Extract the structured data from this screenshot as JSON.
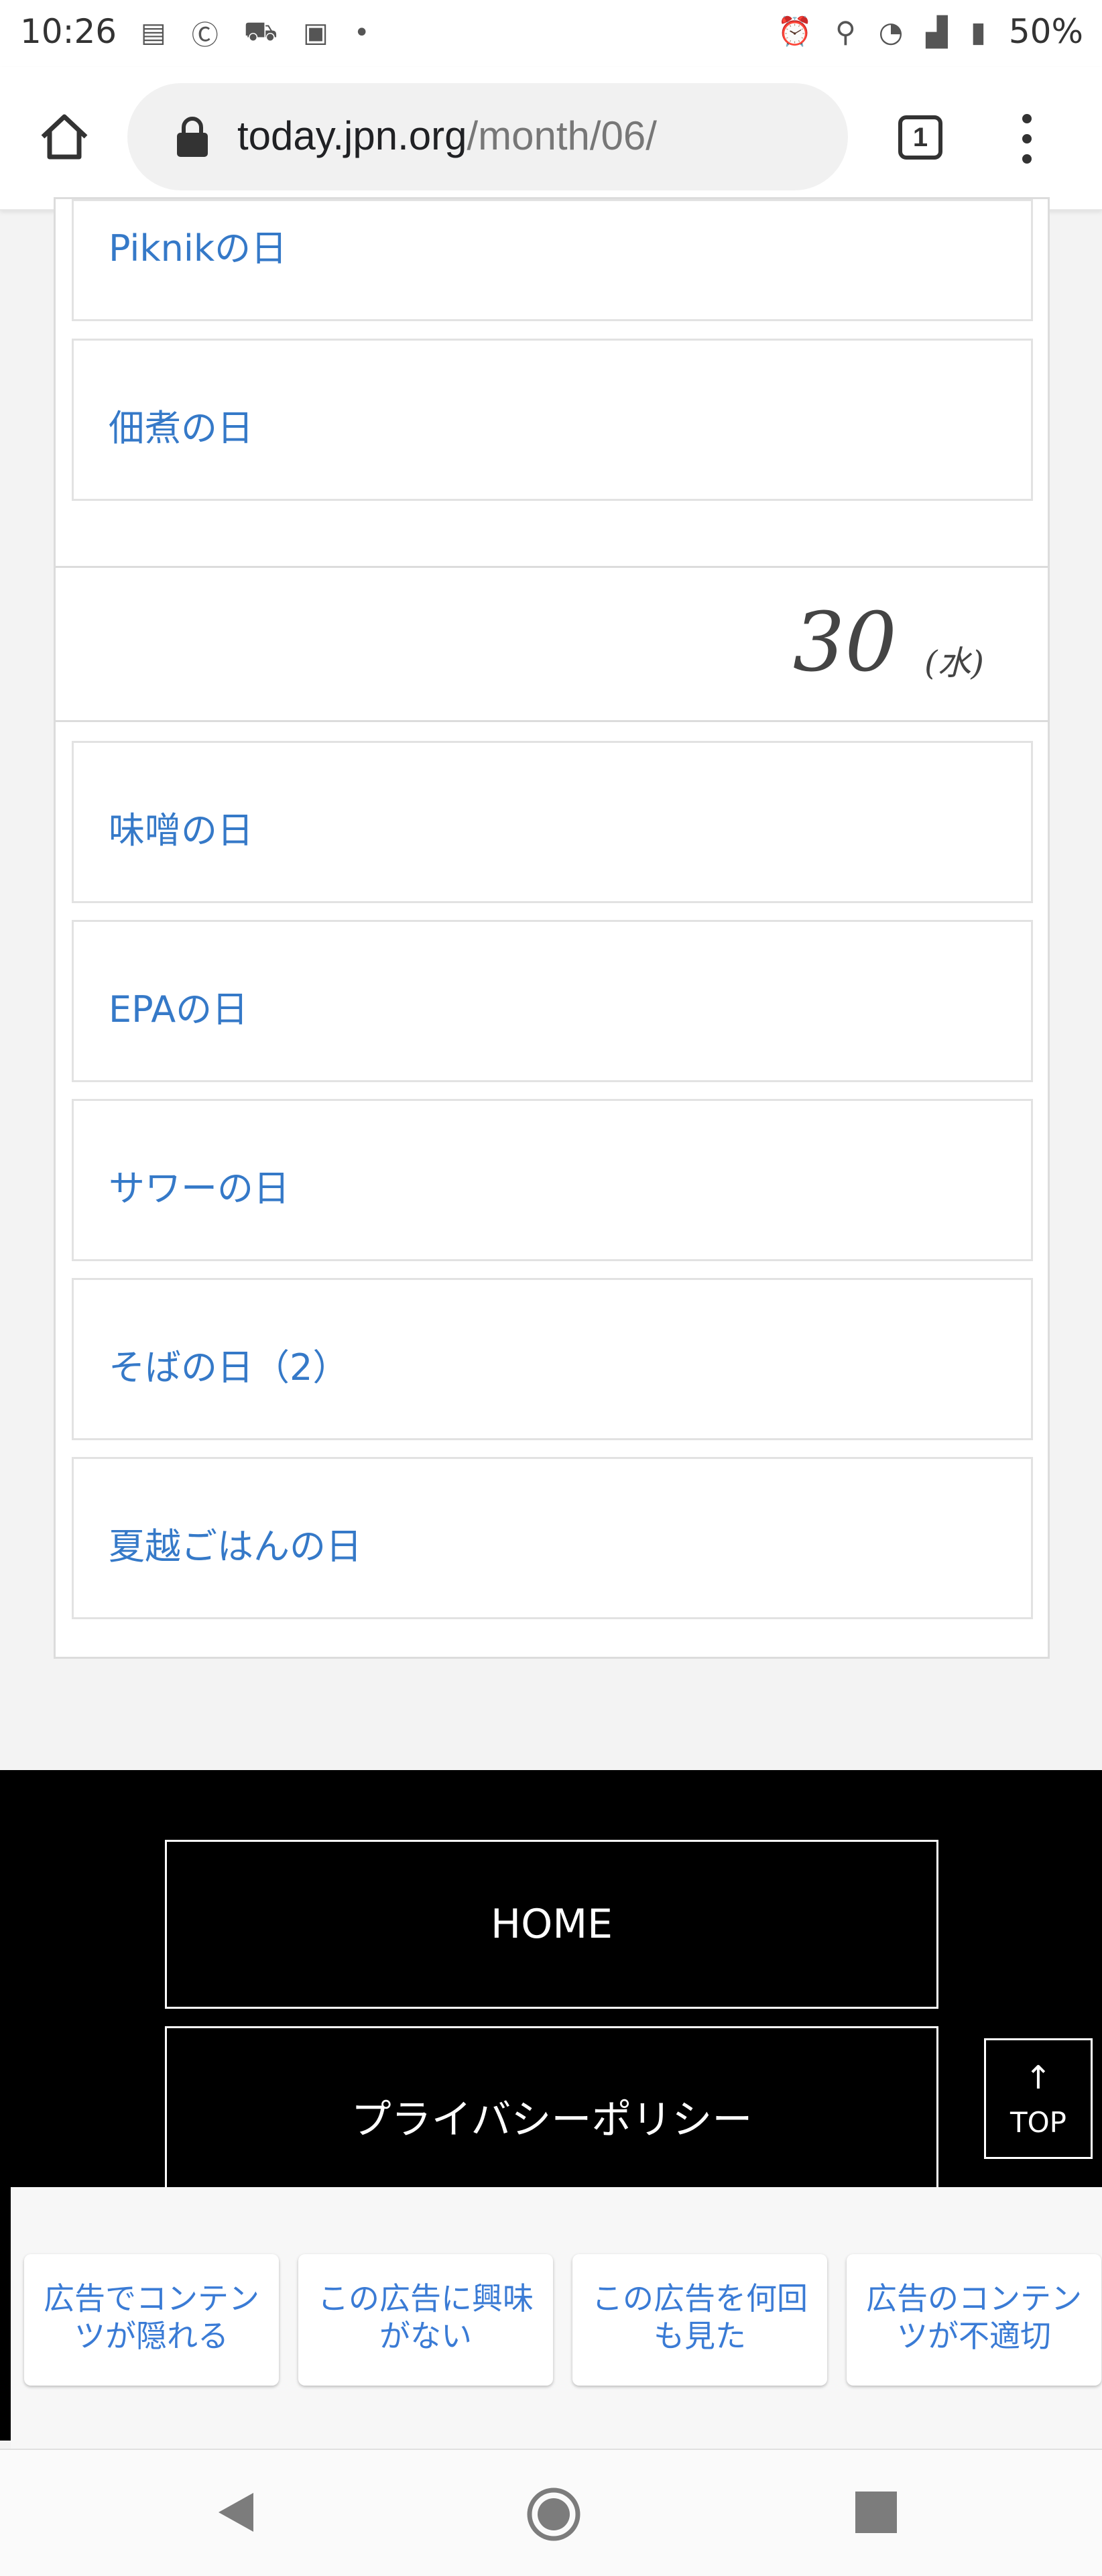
{
  "status_bar": {
    "time": "10:26",
    "left_icons": [
      "newspaper-icon",
      "c-badge-icon",
      "cart-icon",
      "d-icon",
      "dot"
    ],
    "right_icons": [
      "alarm-icon",
      "location-icon",
      "wifi-icon",
      "signal-icon",
      "battery-icon"
    ],
    "battery": "50%"
  },
  "browser": {
    "url_host": "today.jpn.org",
    "url_path": "/month/06/",
    "tab_count": "1"
  },
  "sections": [
    {
      "day_number": "",
      "weekday": "",
      "items": [
        "Piknikの日",
        "佃煮の日"
      ]
    },
    {
      "day_number": "30",
      "weekday": "(水)",
      "items": [
        "味噌の日",
        "EPAの日",
        "サワーの日",
        "そばの日（2）",
        "夏越ごはんの日"
      ]
    }
  ],
  "footer": {
    "home_label": "HOME",
    "privacy_label": "プライバシーポリシー",
    "top_arrow": "↑",
    "top_label": "TOP"
  },
  "ad_feedback": {
    "options": [
      "広告でコンテンツが隠れる",
      "この広告に興味がない",
      "この広告を何回も見た",
      "広告のコンテンツが不適切"
    ]
  },
  "colors": {
    "link": "#3579c8",
    "footer_bg": "#000000",
    "page_bg": "#f3f3f3"
  }
}
